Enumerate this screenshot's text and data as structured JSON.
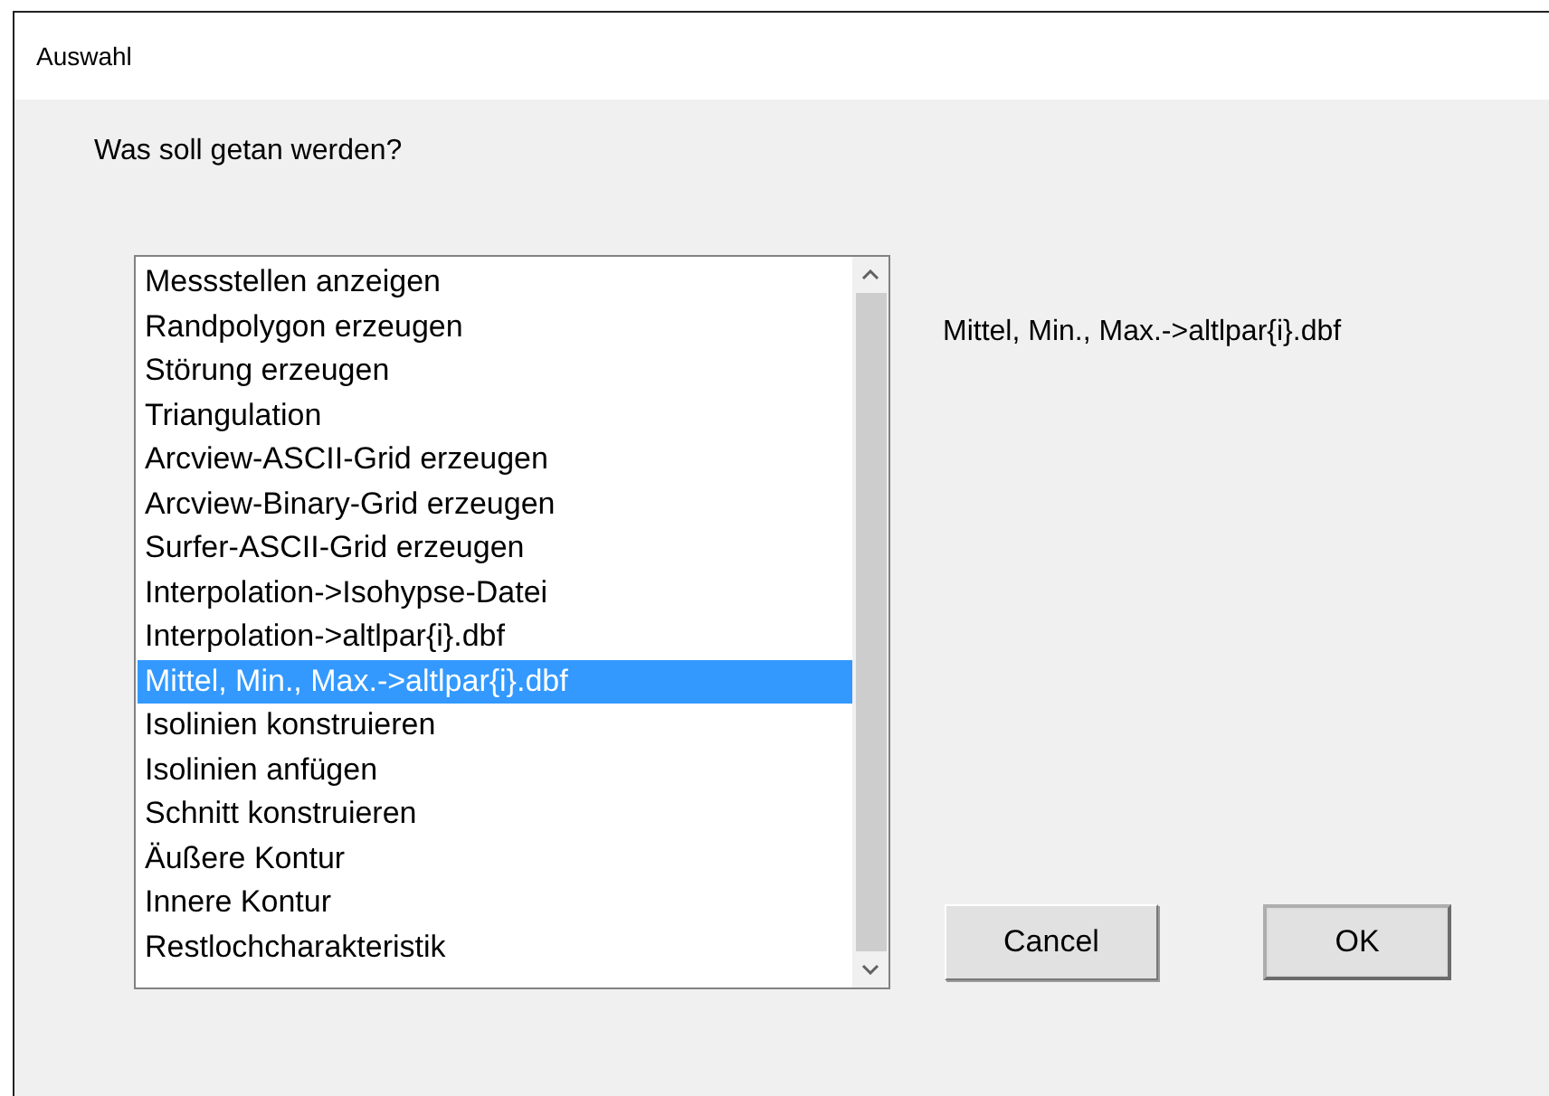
{
  "window": {
    "title": "Auswahl"
  },
  "prompt": "Was soll getan werden?",
  "list": {
    "items": [
      {
        "label": "Messstellen anzeigen",
        "selected": false
      },
      {
        "label": "Randpolygon erzeugen",
        "selected": false
      },
      {
        "label": "Störung erzeugen",
        "selected": false
      },
      {
        "label": "Triangulation",
        "selected": false
      },
      {
        "label": "Arcview-ASCII-Grid erzeugen",
        "selected": false
      },
      {
        "label": "Arcview-Binary-Grid erzeugen",
        "selected": false
      },
      {
        "label": "Surfer-ASCII-Grid erzeugen",
        "selected": false
      },
      {
        "label": "Interpolation->Isohypse-Datei",
        "selected": false
      },
      {
        "label": "Interpolation->altlpar{i}.dbf",
        "selected": false
      },
      {
        "label": "Mittel, Min., Max.->altlpar{i}.dbf",
        "selected": true
      },
      {
        "label": "Isolinien konstruieren",
        "selected": false
      },
      {
        "label": "Isolinien anfügen",
        "selected": false
      },
      {
        "label": "Schnitt konstruieren",
        "selected": false
      },
      {
        "label": "Äußere Kontur",
        "selected": false
      },
      {
        "label": "Innere Kontur",
        "selected": false
      },
      {
        "label": "Restlochcharakteristik",
        "selected": false
      }
    ]
  },
  "description": "Mittel, Min., Max.->altlpar{i}.dbf",
  "buttons": [
    {
      "label": "Cancel",
      "default": false
    },
    {
      "label": "OK",
      "default": true
    }
  ]
}
